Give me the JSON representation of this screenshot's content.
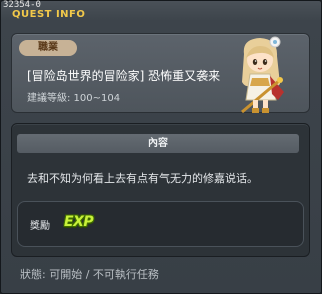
{
  "window": {
    "quest_id": "32354-0",
    "title": "QUEST INFO"
  },
  "quest": {
    "job_label": "職業",
    "name": "[冒险岛世界的冒险家] 恐怖重又袭来",
    "level_range": "建議等級: 100~104"
  },
  "content": {
    "header": "內容",
    "description": "去和不知为何看上去有点有气无力的修嘉说话。"
  },
  "reward": {
    "label": "獎勵",
    "icon_text": "EXP"
  },
  "status": {
    "text": "狀態: 可開始 / 不可執行任務"
  },
  "colors": {
    "title": "#f2c94a",
    "job_pill": "#c7b296",
    "exp": "#c8f23a"
  },
  "icons": {
    "npc": "npc-portrait-icon",
    "exp": "exp-icon"
  }
}
